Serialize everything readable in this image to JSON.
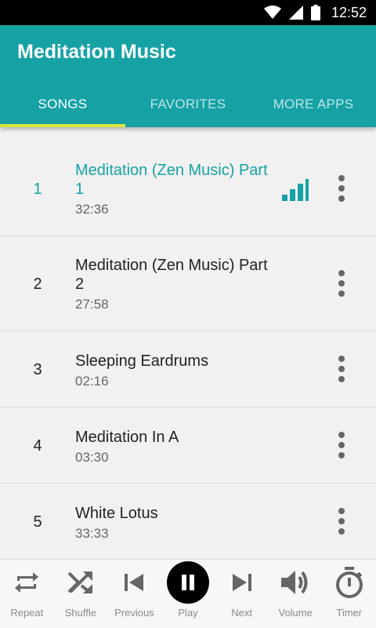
{
  "status_bar": {
    "time": "12:52"
  },
  "app": {
    "title": "Meditation Music"
  },
  "tabs": [
    {
      "label": "SONGS",
      "active": true
    },
    {
      "label": "FAVORITES",
      "active": false
    },
    {
      "label": "MORE APPS",
      "active": false
    }
  ],
  "songs": [
    {
      "number": "1",
      "title": "Meditation (Zen Music) Part 1",
      "duration": "32:36",
      "playing": true
    },
    {
      "number": "2",
      "title": "Meditation (Zen Music) Part 2",
      "duration": "27:58",
      "playing": false
    },
    {
      "number": "3",
      "title": "Sleeping Eardrums",
      "duration": "02:16",
      "playing": false
    },
    {
      "number": "4",
      "title": "Meditation In A",
      "duration": "03:30",
      "playing": false
    },
    {
      "number": "5",
      "title": "White Lotus",
      "duration": "33:33",
      "playing": false
    }
  ],
  "controls": {
    "repeat": "Repeat",
    "shuffle": "Shuffle",
    "previous": "Previous",
    "play": "Play",
    "next": "Next",
    "volume": "Volume",
    "timer": "Timer"
  },
  "colors": {
    "primary": "#16a2a5",
    "tab_indicator": "#d4e83d"
  }
}
